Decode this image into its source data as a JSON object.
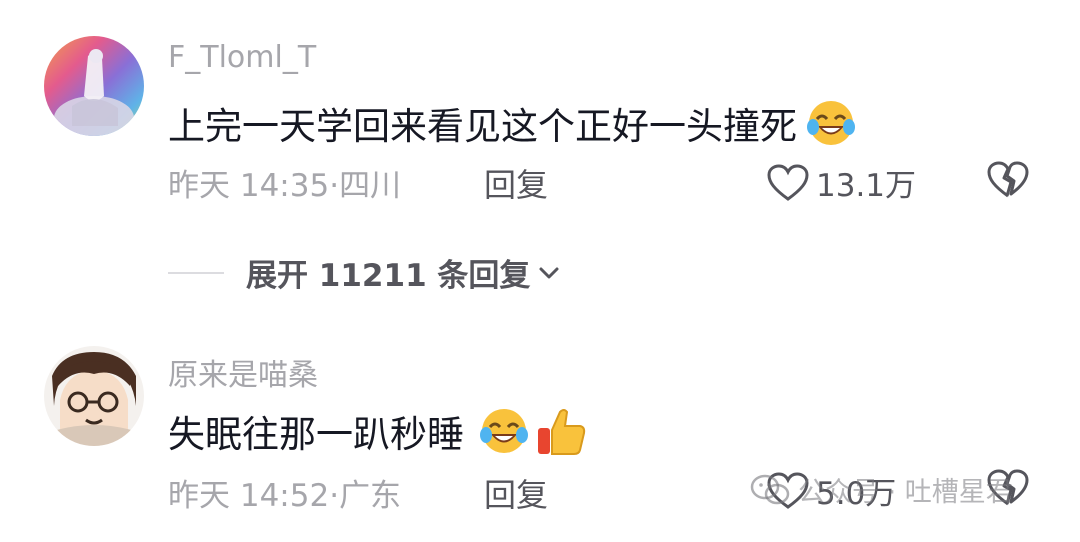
{
  "comments": [
    {
      "username": "F_Tloml_T",
      "text": "上完一天学回来看见这个正好一头撞死",
      "emojis": [
        "laughing-crying-emoji"
      ],
      "time": "昨天 14:35",
      "location": "四川",
      "reply_label": "回复",
      "likes": "13.1万",
      "avatar_icon": "rainbow-statue-avatar"
    },
    {
      "username": "原来是喵桑",
      "text": "失眠往那一趴秒睡",
      "emojis": [
        "laughing-crying-emoji",
        "thumbs-up-emoji"
      ],
      "time": "昨天 14:52",
      "location": "广东",
      "reply_label": "回复",
      "likes": "5.0万",
      "avatar_icon": "cartoon-girl-avatar"
    }
  ],
  "expand_replies": {
    "label": "展开 11211 条回复"
  },
  "watermark": {
    "text": "公众号 · 吐槽星君"
  },
  "colors": {
    "text_primary": "#161823",
    "text_secondary": "#a6a6ab",
    "text_action": "#55555c"
  }
}
